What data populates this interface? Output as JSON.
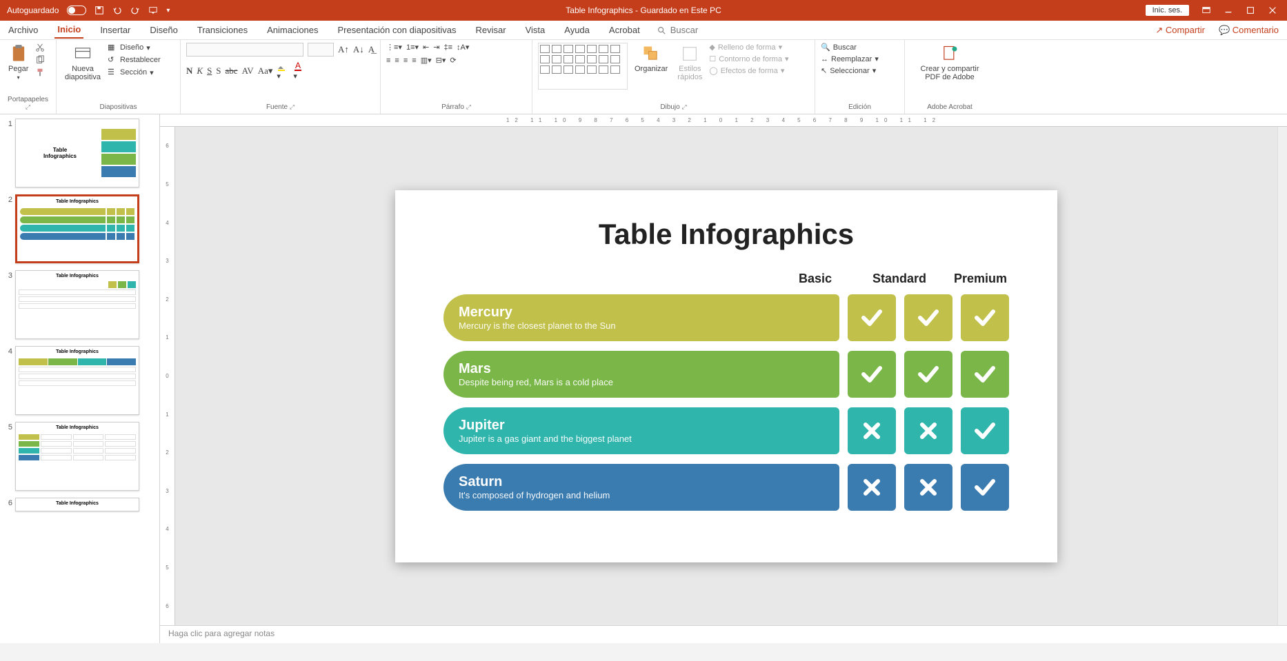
{
  "titlebar": {
    "autosave": "Autoguardado",
    "doc_title": "Table Infographics  -  Guardado en Este PC",
    "signin": "Inic. ses."
  },
  "menu": {
    "archivo": "Archivo",
    "inicio": "Inicio",
    "insertar": "Insertar",
    "diseno": "Diseño",
    "transiciones": "Transiciones",
    "animaciones": "Animaciones",
    "presentacion": "Presentación con diapositivas",
    "revisar": "Revisar",
    "vista": "Vista",
    "ayuda": "Ayuda",
    "acrobat": "Acrobat",
    "buscar_placeholder": "Buscar",
    "compartir": "Compartir",
    "comentario": "Comentario"
  },
  "ribbon": {
    "portapapeles": {
      "label": "Portapapeles",
      "pegar": "Pegar"
    },
    "diapositivas": {
      "label": "Diapositivas",
      "nueva": "Nueva\ndiapositiva",
      "diseno": "Diseño",
      "restablecer": "Restablecer",
      "seccion": "Sección"
    },
    "fuente": {
      "label": "Fuente"
    },
    "parrafo": {
      "label": "Párrafo"
    },
    "dibujo": {
      "label": "Dibujo",
      "organizar": "Organizar",
      "estilos": "Estilos\nrápidos",
      "relleno": "Relleno de forma",
      "contorno": "Contorno de forma",
      "efectos": "Efectos de forma"
    },
    "edicion": {
      "label": "Edición",
      "buscar": "Buscar",
      "reemplazar": "Reemplazar",
      "seleccionar": "Seleccionar"
    },
    "acrobat": {
      "label": "Adobe Acrobat",
      "crear": "Crear y compartir\nPDF de Adobe"
    }
  },
  "thumbs": {
    "t1": "Table\nInfographics",
    "t2": "Table Infographics",
    "t3": "Table Infographics",
    "t4": "Table Infographics",
    "t5": "Table Infographics",
    "t6": "Table Infographics"
  },
  "slide": {
    "title": "Table Infographics",
    "cols": {
      "c1": "Basic",
      "c2": "Standard",
      "c3": "Premium"
    },
    "rows": [
      {
        "name": "Mercury",
        "sub": "Mercury is the closest planet to the Sun",
        "cells": [
          "check",
          "check",
          "check"
        ],
        "color": "c-olive"
      },
      {
        "name": "Mars",
        "sub": "Despite being red, Mars is a cold place",
        "cells": [
          "check",
          "check",
          "check"
        ],
        "color": "c-green"
      },
      {
        "name": "Jupiter",
        "sub": "Jupiter is a gas giant and the biggest planet",
        "cells": [
          "x",
          "x",
          "check"
        ],
        "color": "c-teal"
      },
      {
        "name": "Saturn",
        "sub": "It's composed of hydrogen and helium",
        "cells": [
          "x",
          "x",
          "check"
        ],
        "color": "c-blue"
      }
    ]
  },
  "notes": {
    "placeholder": "Haga clic para agregar notas"
  },
  "ruler": {
    "h": "12  11  10  9  8  7  6  5  4  3  2  1  0  1  2  3  4  5  6  7  8  9  10  11  12",
    "v": [
      "6",
      "5",
      "4",
      "3",
      "2",
      "1",
      "0",
      "1",
      "2",
      "3",
      "4",
      "5",
      "6"
    ]
  }
}
